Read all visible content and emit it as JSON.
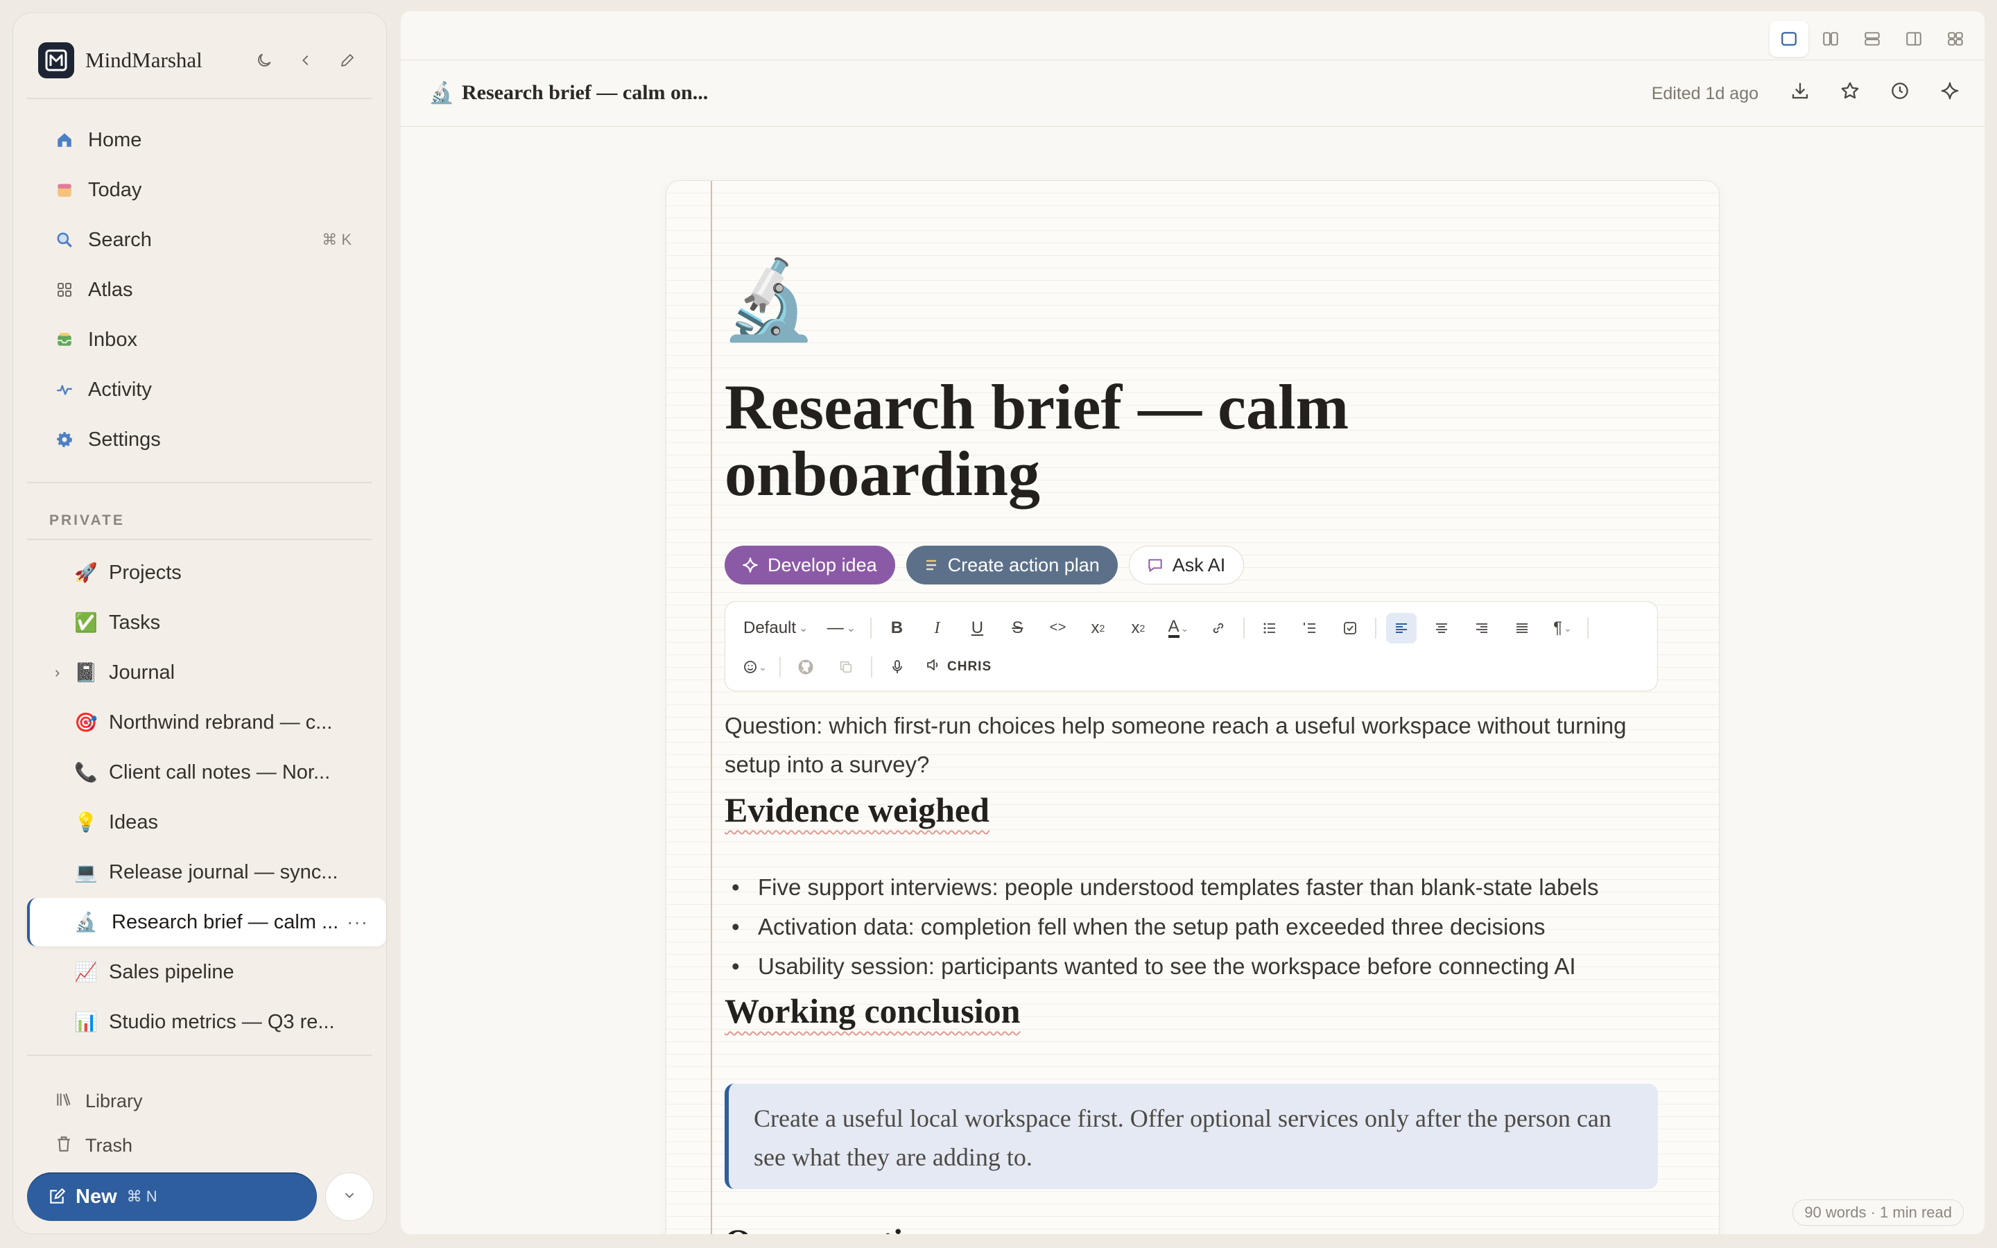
{
  "app": {
    "name": "MindMarshal"
  },
  "sidebar": {
    "nav": [
      {
        "label": "Home",
        "icon": "home-icon"
      },
      {
        "label": "Today",
        "icon": "calendar-icon"
      },
      {
        "label": "Search",
        "icon": "search-icon",
        "shortcut": "⌘ K"
      },
      {
        "label": "Atlas",
        "icon": "grid-icon"
      },
      {
        "label": "Inbox",
        "icon": "inbox-icon"
      },
      {
        "label": "Activity",
        "icon": "activity-icon"
      },
      {
        "label": "Settings",
        "icon": "gear-icon"
      }
    ],
    "section_label": "PRIVATE",
    "pages": [
      {
        "label": "Projects",
        "emoji": "🚀"
      },
      {
        "label": "Tasks",
        "emoji": "✅"
      },
      {
        "label": "Journal",
        "emoji": "📓",
        "expandable": true
      },
      {
        "label": "Northwind rebrand — c...",
        "emoji": "🎯"
      },
      {
        "label": "Client call notes — Nor...",
        "emoji": "📞"
      },
      {
        "label": "Ideas",
        "emoji": "💡"
      },
      {
        "label": "Release journal — sync...",
        "emoji": "💻"
      },
      {
        "label": "Research brief — calm ...",
        "emoji": "🔬",
        "active": true,
        "more": "···"
      },
      {
        "label": "Sales pipeline",
        "emoji": "📈"
      },
      {
        "label": "Studio metrics — Q3 re...",
        "emoji": "📊"
      }
    ],
    "footer": [
      {
        "label": "Library",
        "icon": "library-icon"
      },
      {
        "label": "Trash",
        "icon": "trash-icon"
      }
    ],
    "new_button": {
      "label": "New",
      "shortcut": "⌘ N"
    }
  },
  "topbar": {
    "emoji": "🔬",
    "title": "Research brief — calm on...",
    "edited": "Edited 1d ago"
  },
  "document": {
    "emoji": "🔬",
    "title": "Research brief — calm onboarding",
    "ai_actions": [
      {
        "label": "Develop idea"
      },
      {
        "label": "Create action plan"
      },
      {
        "label": "Ask AI"
      }
    ],
    "toolbar": {
      "style_select": "Default",
      "size_select": "—",
      "voice_label": "CHRIS"
    },
    "question": "Question: which first-run choices help someone reach a useful workspace without turning setup into a survey?",
    "h_evidence": "Evidence weighed",
    "evidence": [
      "Five support interviews: people understood templates faster than blank-state labels",
      "Activation data: completion fell when the setup path exceeded three decisions",
      "Usability session: participants wanted to see the workspace before connecting AI"
    ],
    "h_conclusion": "Working conclusion",
    "conclusion": "Create a useful local workspace first. Offer optional services only after the person can see what they are adding to.",
    "h_open": "Open questions"
  },
  "status": {
    "wordcount": "90 words · 1 min read"
  },
  "colors": {
    "accent": "#2f5e9e",
    "develop": "#8b5aa6",
    "action_plan": "#5c7189",
    "quote_bg": "#e4e9f3"
  }
}
